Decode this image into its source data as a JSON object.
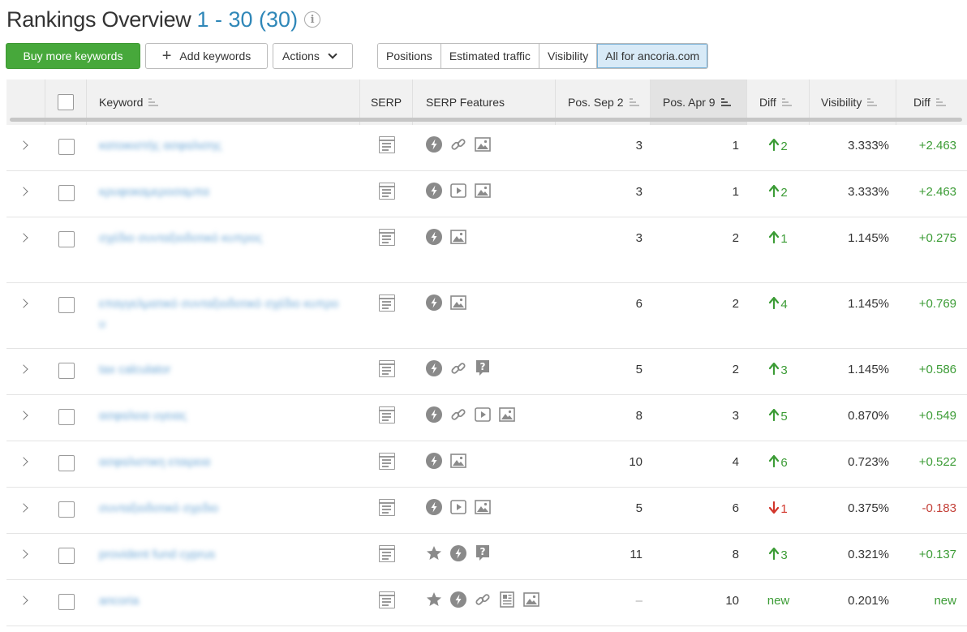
{
  "header": {
    "title": "Rankings Overview",
    "range": "1 - 30 (30)",
    "info_icon": "info-icon"
  },
  "toolbar": {
    "buy_label": "Buy more keywords",
    "add_label": "Add keywords",
    "actions_label": "Actions"
  },
  "view_tabs": [
    "Positions",
    "Estimated traffic",
    "Visibility",
    "All for ancoria.com"
  ],
  "active_tab": "All for ancoria.com",
  "columns": {
    "keyword": "Keyword",
    "serp": "SERP",
    "serp_features": "SERP Features",
    "pos_sep": "Pos. Sep 2",
    "pos_apr": "Pos. Apr 9",
    "diff": "Diff",
    "visibility": "Visibility",
    "vis_diff": "Diff"
  },
  "colors": {
    "green_button": "#47a83b",
    "link": "#2f87b8",
    "positive": "#3c9c36",
    "negative": "#c44038"
  },
  "rows": [
    {
      "keyword": "κατοικιστής ασφαλισης",
      "features": [
        "bolt",
        "link",
        "image"
      ],
      "pos_sep": "3",
      "pos_apr": "1",
      "diff_dir": "up",
      "diff": "2",
      "visibility": "3.333%",
      "vis_diff": "+2.463",
      "vis_sign": "pos",
      "tall": false
    },
    {
      "keyword": "κρυφοκαμεροσαμπα",
      "features": [
        "bolt",
        "video",
        "image"
      ],
      "pos_sep": "3",
      "pos_apr": "1",
      "diff_dir": "up",
      "diff": "2",
      "visibility": "3.333%",
      "vis_diff": "+2.463",
      "vis_sign": "pos",
      "tall": false
    },
    {
      "keyword": "σχέδιο συνταξιοδοτικό κυπρος",
      "features": [
        "bolt",
        "image"
      ],
      "pos_sep": "3",
      "pos_apr": "2",
      "diff_dir": "up",
      "diff": "1",
      "visibility": "1.145%",
      "vis_diff": "+0.275",
      "vis_sign": "pos",
      "tall": true
    },
    {
      "keyword": "επαγγελματικό συνταξιοδοτικό σχέδιο κυπρου",
      "features": [
        "bolt",
        "image"
      ],
      "pos_sep": "6",
      "pos_apr": "2",
      "diff_dir": "up",
      "diff": "4",
      "visibility": "1.145%",
      "vis_diff": "+0.769",
      "vis_sign": "pos",
      "tall": true
    },
    {
      "keyword": "tax calculator",
      "features": [
        "bolt",
        "link",
        "question"
      ],
      "pos_sep": "5",
      "pos_apr": "2",
      "diff_dir": "up",
      "diff": "3",
      "visibility": "1.145%",
      "vis_diff": "+0.586",
      "vis_sign": "pos",
      "tall": false
    },
    {
      "keyword": "ασφαλεια υγειας",
      "features": [
        "bolt",
        "link",
        "video",
        "image"
      ],
      "pos_sep": "8",
      "pos_apr": "3",
      "diff_dir": "up",
      "diff": "5",
      "visibility": "0.870%",
      "vis_diff": "+0.549",
      "vis_sign": "pos",
      "tall": false
    },
    {
      "keyword": "ασφαλιστικη εταιρεια",
      "features": [
        "bolt",
        "image"
      ],
      "pos_sep": "10",
      "pos_apr": "4",
      "diff_dir": "up",
      "diff": "6",
      "visibility": "0.723%",
      "vis_diff": "+0.522",
      "vis_sign": "pos",
      "tall": false
    },
    {
      "keyword": "συνταξιοδοτικό σχεδιο",
      "features": [
        "bolt",
        "video",
        "image"
      ],
      "pos_sep": "5",
      "pos_apr": "6",
      "diff_dir": "down",
      "diff": "1",
      "visibility": "0.375%",
      "vis_diff": "-0.183",
      "vis_sign": "neg",
      "tall": false
    },
    {
      "keyword": "provident fund cyprus",
      "features": [
        "star",
        "bolt",
        "question"
      ],
      "pos_sep": "11",
      "pos_apr": "8",
      "diff_dir": "up",
      "diff": "3",
      "visibility": "0.321%",
      "vis_diff": "+0.137",
      "vis_sign": "pos",
      "tall": false
    },
    {
      "keyword": "ancoria",
      "features": [
        "star",
        "bolt",
        "link",
        "news",
        "image"
      ],
      "pos_sep": "–",
      "pos_apr": "10",
      "diff_dir": "new",
      "diff": "new",
      "visibility": "0.201%",
      "vis_diff": "new",
      "vis_sign": "pos",
      "tall": false
    }
  ]
}
